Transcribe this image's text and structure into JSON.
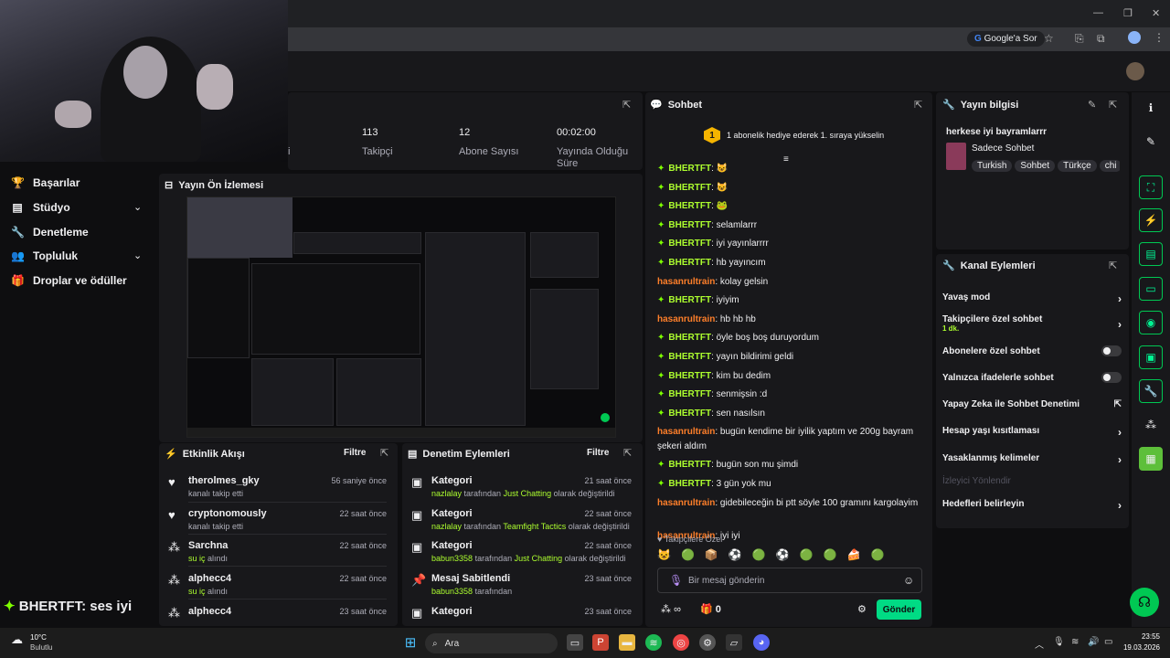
{
  "browser": {
    "search_chip": "Google'a Sor"
  },
  "left_nav": {
    "items": [
      {
        "label": "Başarılar",
        "icon": "trophy-icon"
      },
      {
        "label": "Stüdyo",
        "icon": "film-icon",
        "expand": true
      },
      {
        "label": "Denetleme",
        "icon": "wrench-icon"
      },
      {
        "label": "Topluluk",
        "icon": "people-icon",
        "expand": true
      },
      {
        "label": "Droplar ve ödüller",
        "icon": "gift-icon"
      }
    ],
    "overlay_user": "BHERTFT",
    "overlay_msg": ": ses iyi"
  },
  "stats": {
    "partial_label": "i",
    "followers_value": "113",
    "followers_label": "Takipçi",
    "subs_value": "12",
    "subs_label": "Abone Sayısı",
    "uptime_value": "00:02:00",
    "uptime_label_1": "Yayında Olduğu",
    "uptime_label_2": "Süre"
  },
  "preview": {
    "title": "Yayın Ön İzlemesi"
  },
  "activity_feed": {
    "title": "Etkinlik Akışı",
    "filter": "Filtre",
    "items": [
      {
        "name": "therolmes_gky",
        "sub": "kanalı takip etti",
        "time": "56 saniye önce",
        "icon": "heart-icon"
      },
      {
        "name": "cryptonomously",
        "sub": "kanalı takip etti",
        "time": "22 saat önce",
        "icon": "heart-icon"
      },
      {
        "name": "Sarchna",
        "sub_a": "su iç",
        "sub_b": " alındı",
        "time": "22 saat önce",
        "icon": "points-icon"
      },
      {
        "name": "alphecc4",
        "sub_a": "su iç",
        "sub_b": " alındı",
        "time": "22 saat önce",
        "icon": "points-icon"
      },
      {
        "name": "alphecc4",
        "sub": "",
        "time": "23 saat önce",
        "icon": "points-icon"
      }
    ]
  },
  "mod_actions": {
    "title": "Denetim Eylemleri",
    "filter": "Filtre",
    "items": [
      {
        "title": "Kategori",
        "who": "nazlalay",
        "mid": " tarafından ",
        "what": "Just Chatting",
        "end": " olarak değiştirildi",
        "time": "21 saat önce"
      },
      {
        "title": "Kategori",
        "who": "nazlalay",
        "mid": " tarafından ",
        "what": "Teamfight Tactics",
        "end": " olarak değiştirildi",
        "time": "22 saat önce"
      },
      {
        "title": "Kategori",
        "who": "babun3358",
        "mid": " tarafından ",
        "what": "Just Chatting",
        "end": " olarak değiştirildi",
        "time": "22 saat önce"
      },
      {
        "title": "Mesaj Sabitlendi",
        "who": "babun3358",
        "mid": " tarafından",
        "what": "",
        "end": "",
        "time": "23 saat önce"
      },
      {
        "title": "Kategori",
        "who": "",
        "mid": "",
        "what": "",
        "end": "",
        "time": "23 saat önce"
      }
    ]
  },
  "chat": {
    "title": "Sohbet",
    "hype_rank": "1",
    "hype_text": "1 abonelik hediye ederek 1. sıraya yükselin",
    "messages": [
      {
        "user": "BHERTFT",
        "text": ": 😺",
        "type": "a"
      },
      {
        "user": "BHERTFT",
        "text": ": 😺",
        "type": "a"
      },
      {
        "user": "BHERTFT",
        "text": ": 🐸",
        "type": "a"
      },
      {
        "user": "BHERTFT",
        "text": ": selamlarrr",
        "type": "a"
      },
      {
        "user": "BHERTFT",
        "text": ": iyi yayınlarrrr",
        "type": "a"
      },
      {
        "user": "BHERTFT",
        "text": ": hb yayıncım",
        "type": "a"
      },
      {
        "user": "hasanrultrain",
        "text": ": kolay gelsin",
        "type": "b"
      },
      {
        "user": "BHERTFT",
        "text": ": iyiyim",
        "type": "a"
      },
      {
        "user": "hasanrultrain",
        "text": ": hb hb hb",
        "type": "b"
      },
      {
        "user": "BHERTFT",
        "text": ": öyle boş boş duruyordum",
        "type": "a"
      },
      {
        "user": "BHERTFT",
        "text": ": yayın bildirimi geldi",
        "type": "a"
      },
      {
        "user": "BHERTFT",
        "text": ": kim bu dedim",
        "type": "a"
      },
      {
        "user": "BHERTFT",
        "text": ": senmişsin :d",
        "type": "a"
      },
      {
        "user": "BHERTFT",
        "text": ": sen nasılsın",
        "type": "a"
      },
      {
        "user": "hasanrultrain",
        "text": ": bugün kendime bir iyilik yaptım ve 200g bayram şekeri aldım",
        "type": "b"
      },
      {
        "user": "BHERTFT",
        "text": ": bugün son mu şimdi",
        "type": "a"
      },
      {
        "user": "BHERTFT",
        "text": ": 3 gün yok mu",
        "type": "a"
      },
      {
        "user": "hasanrultrain",
        "text": ": gidebileceğin bi ptt söyle 100 gramını kargolayim",
        "type": "b"
      },
      {
        "user": "hasanrultrain",
        "text": ": iyi iyi",
        "type": "b"
      }
    ],
    "followers_only_label": "Takipçilere Özel",
    "emotes": [
      "😺",
      "🟢",
      "📦",
      "⚽",
      "🟢",
      "⚽",
      "🟢",
      "🟢",
      "🍰",
      "🟢"
    ],
    "input_placeholder": "Bir mesaj gönderin",
    "points_value": "∞",
    "drops_value": "0",
    "send_label": "Gönder"
  },
  "stream_info": {
    "title": "Yayın bilgisi",
    "stream_title": "herkese iyi bayramlarrr",
    "category": "Sadece Sohbet",
    "tags": [
      "Turkish",
      "Sohbet",
      "Türkçe",
      "chi"
    ]
  },
  "channel_actions": {
    "title": "Kanal Eylemleri",
    "rows": [
      {
        "label": "Yavaş mod",
        "kind": "chevron"
      },
      {
        "label": "Takipçilere özel sohbet",
        "kind": "chevron",
        "sub": "1 dk."
      },
      {
        "label": "Abonelere özel sohbet",
        "kind": "toggle"
      },
      {
        "label": "Yalnızca ifadelerle sohbet",
        "kind": "toggle"
      },
      {
        "label": "Yapay Zeka ile Sohbet Denetimi",
        "kind": "external"
      },
      {
        "label": "Hesap yaşı kısıtlaması",
        "kind": "chevron"
      },
      {
        "label": "Yasaklanmış kelimeler",
        "kind": "chevron"
      },
      {
        "label": "İzleyici Yönlendir",
        "kind": "disabled"
      },
      {
        "label": "Hedefleri belirleyin",
        "kind": "chevron"
      }
    ]
  },
  "taskbar": {
    "weather_temp": "10°C",
    "weather_desc": "Bulutlu",
    "search_label": "Ara",
    "time": "23:55",
    "date": "19.03.2026"
  },
  "colors": {
    "accent_green": "#00f593",
    "chat_green": "#adff2f",
    "chat_orange": "#ff7f2a",
    "send_button": "#00db84"
  }
}
